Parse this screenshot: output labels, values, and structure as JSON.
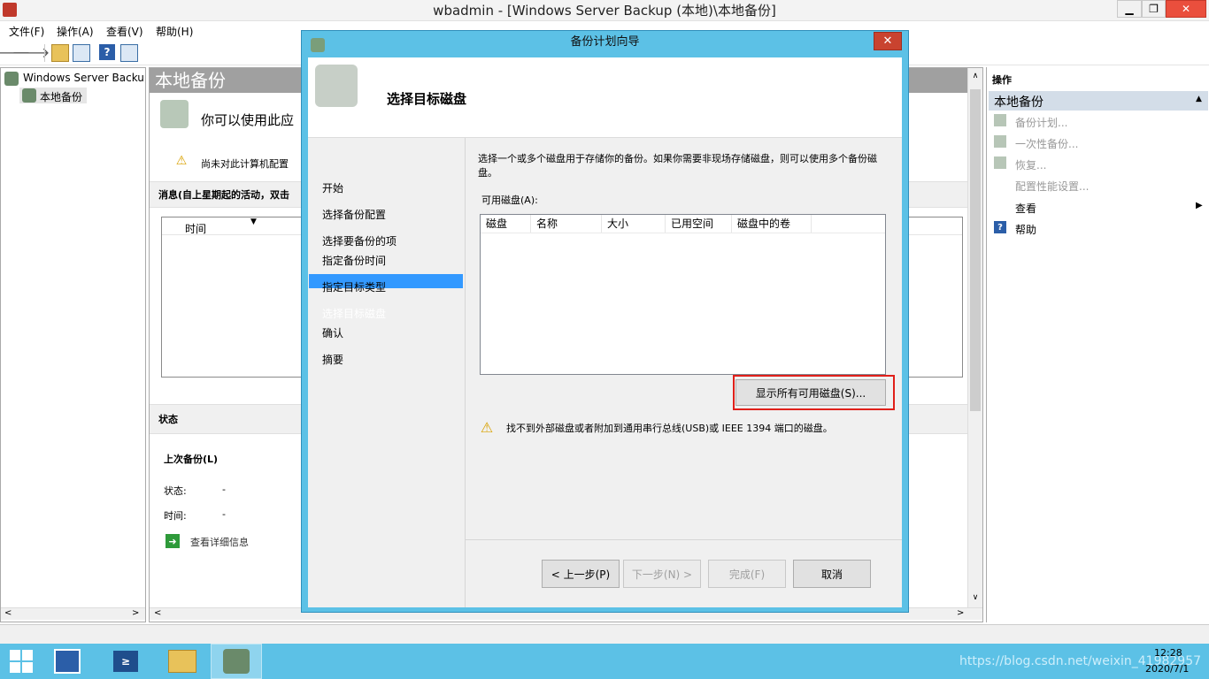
{
  "window": {
    "title": "wbadmin - [Windows Server Backup (本地)\\本地备份]",
    "minimize": "▁",
    "maximize": "❐",
    "close": "✕"
  },
  "menu": [
    "文件(F)",
    "操作(A)",
    "查看(V)",
    "帮助(H)"
  ],
  "tree": {
    "root": "Windows Server Backup",
    "child": "本地备份"
  },
  "center": {
    "header": "本地备份",
    "intro": "你可以使用此应",
    "warning": "尚未对此计算机配置",
    "messages_title": "消息(自上星期起的活动，双击",
    "messages_col_time": "时间",
    "status_title": "状态",
    "last_backup": "上次备份(L)",
    "status_label": "状态:",
    "status_value": "-",
    "time_label": "时间:",
    "time_value": "-",
    "details_link": "查看详细信息"
  },
  "actions": {
    "title": "操作",
    "section": "本地备份",
    "items": [
      "备份计划...",
      "一次性备份...",
      "恢复...",
      "配置性能设置..."
    ],
    "view": "查看",
    "help": "帮助"
  },
  "dialog": {
    "title": "备份计划向导",
    "close": "✕",
    "heading": "选择目标磁盘",
    "nav": [
      "开始",
      "选择备份配置",
      "选择要备份的项",
      "指定备份时间",
      "指定目标类型",
      "选择目标磁盘",
      "确认",
      "摘要"
    ],
    "nav_selected_index": 5,
    "description": "选择一个或多个磁盘用于存储你的备份。如果你需要非现场存储磁盘，则可以使用多个备份磁盘。",
    "list_label": "可用磁盘(A):",
    "columns": [
      "磁盘",
      "名称",
      "大小",
      "已用空间",
      "磁盘中的卷"
    ],
    "show_all_button": "显示所有可用磁盘(S)...",
    "warning": "找不到外部磁盘或者附加到通用串行总线(USB)或 IEEE 1394 端口的磁盘。",
    "buttons": {
      "back": "< 上一步(P)",
      "next": "下一步(N) >",
      "finish": "完成(F)",
      "cancel": "取消"
    }
  },
  "taskbar": {
    "time": "12:28",
    "date": "2020/7/1",
    "watermark": "https://blog.csdn.net/weixin_41982957"
  },
  "colors": {
    "accent": "#5cc1e6",
    "highlight": "#3399ff",
    "header_gray": "#a0a0a0",
    "callout_red": "#e0201a"
  }
}
